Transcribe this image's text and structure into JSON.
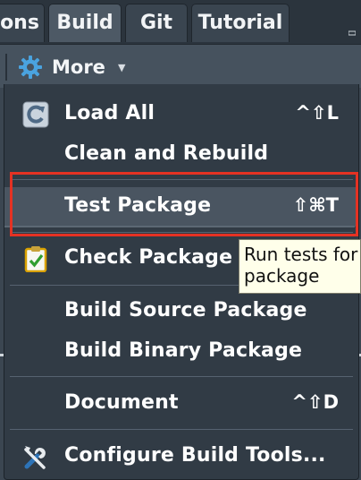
{
  "tabs": [
    {
      "label": "ons",
      "active": false
    },
    {
      "label": "Build",
      "active": true
    },
    {
      "label": "Git",
      "active": false
    },
    {
      "label": "Tutorial",
      "active": false
    }
  ],
  "toolbar": {
    "more_label": "More",
    "more_icon": "gear-icon",
    "caret_icon": "chevron-down-icon"
  },
  "menu": {
    "items": [
      {
        "label": "Load All",
        "shortcut": "^⇧L",
        "icon": "reload-icon"
      },
      {
        "label": "Clean and Rebuild",
        "shortcut": ""
      },
      {
        "label": "Test Package",
        "shortcut": "⇧⌘T",
        "highlighted": true
      },
      {
        "label": "Check Package",
        "shortcut": "",
        "icon": "clipboard-check-icon"
      },
      {
        "label": "Build Source Package",
        "shortcut": ""
      },
      {
        "label": "Build Binary Package",
        "shortcut": ""
      },
      {
        "label": "Document",
        "shortcut": "^⇧D"
      },
      {
        "label": "Configure Build Tools...",
        "shortcut": "",
        "icon": "tools-icon"
      }
    ]
  },
  "tooltip": {
    "line1": "Run tests for",
    "line2": "package"
  },
  "colors": {
    "highlight_box": "#e53223",
    "menu_bg": "#313b45",
    "tooltip_bg": "#ffffea"
  }
}
